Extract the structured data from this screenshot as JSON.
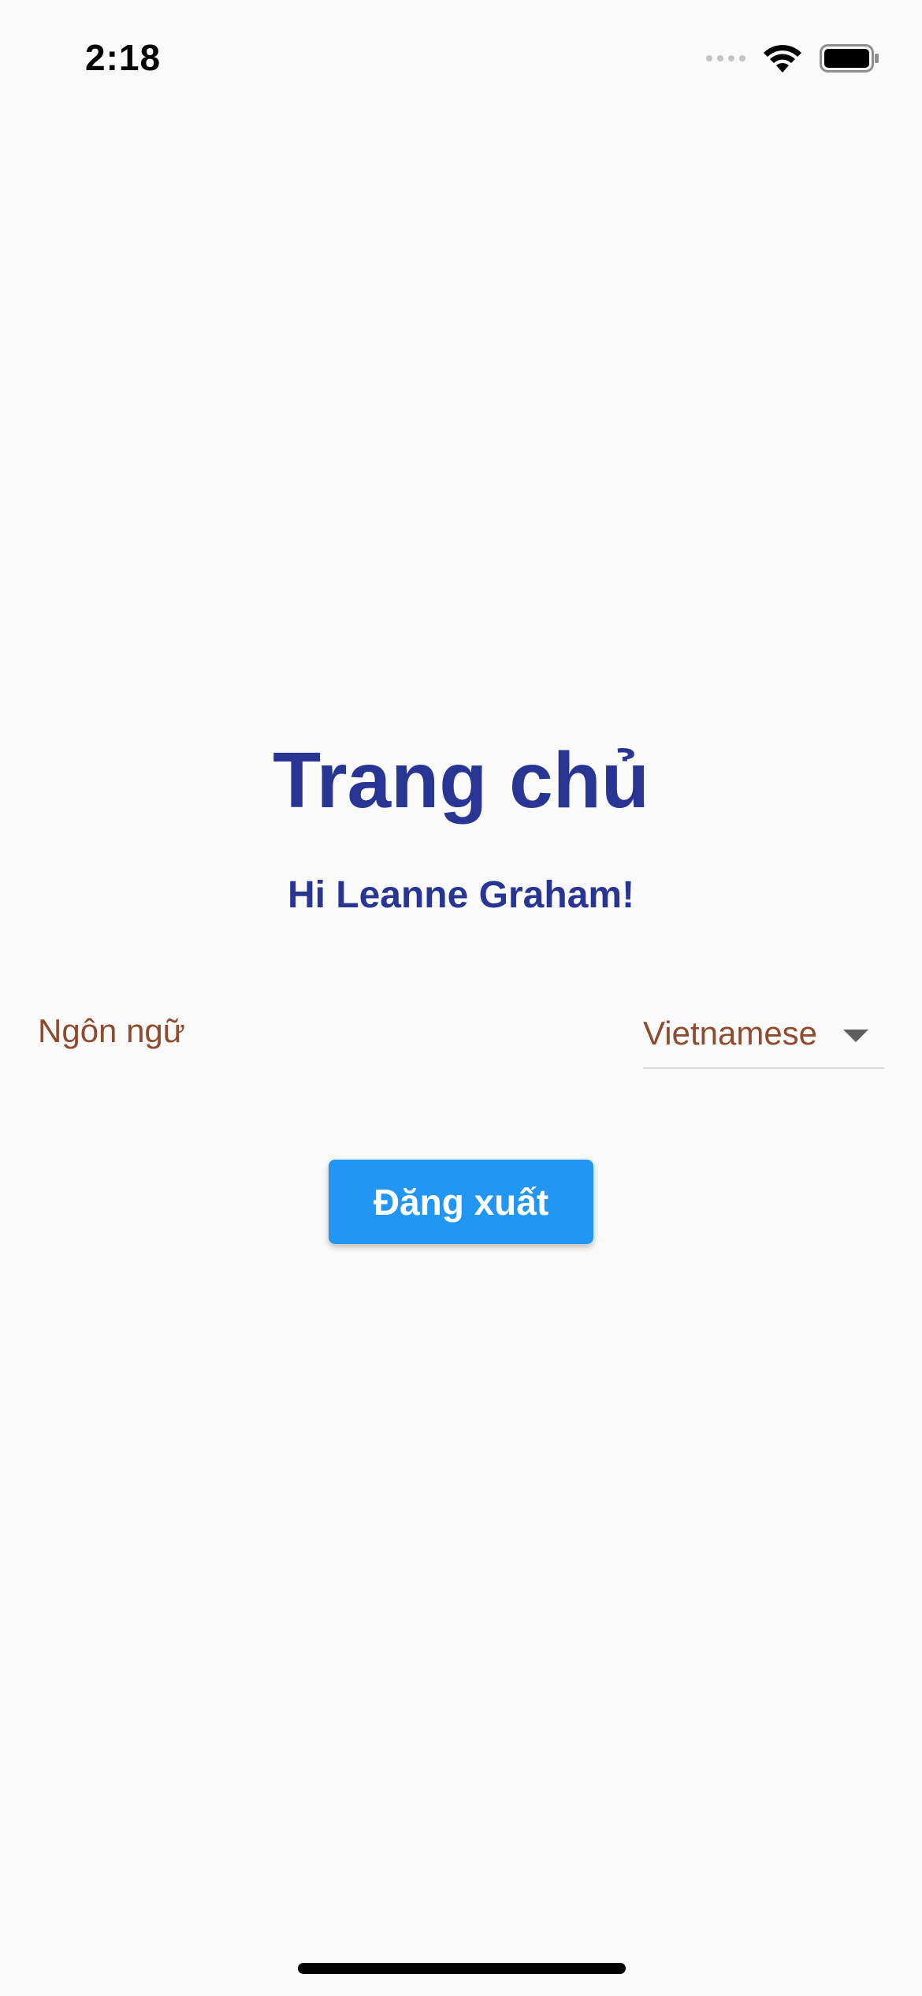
{
  "status_bar": {
    "time": "2:18",
    "icons": [
      "signal-icon",
      "wifi-icon",
      "battery-icon"
    ]
  },
  "main": {
    "title": "Trang chủ",
    "greeting": "Hi Leanne Graham!",
    "language": {
      "label": "Ngôn ngữ",
      "selected": "Vietnamese"
    },
    "logout_label": "Đăng xuất"
  },
  "colors": {
    "background": "#fafafa",
    "title": "#283593",
    "language_text": "#8d4b2f",
    "button": "#2196f3",
    "button_text": "#ffffff"
  }
}
